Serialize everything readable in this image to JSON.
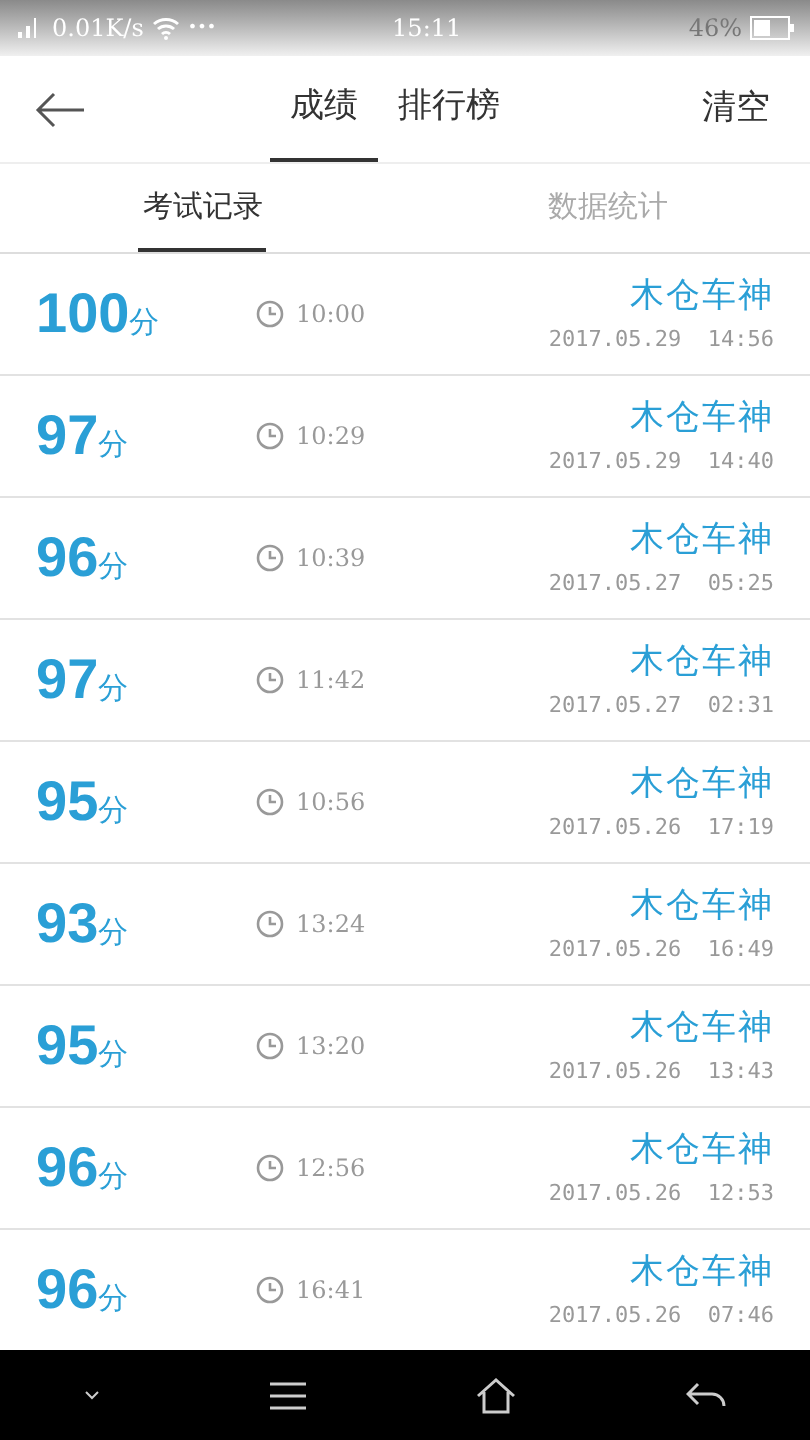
{
  "status_bar": {
    "speed": "0.01K/s",
    "dots": "•••",
    "time": "15:11",
    "battery": "46%"
  },
  "header": {
    "tabs": [
      {
        "label": "成绩",
        "selected": true
      },
      {
        "label": "排行榜",
        "selected": false
      }
    ],
    "action": "清空"
  },
  "sub_tabs": [
    {
      "label": "考试记录",
      "selected": true
    },
    {
      "label": "数据统计",
      "selected": false
    }
  ],
  "records": [
    {
      "score": "100",
      "unit": "分",
      "duration": "10:00",
      "name": "木仓车神",
      "date": "2017.05.29  14:56"
    },
    {
      "score": "97",
      "unit": "分",
      "duration": "10:29",
      "name": "木仓车神",
      "date": "2017.05.29  14:40"
    },
    {
      "score": "96",
      "unit": "分",
      "duration": "10:39",
      "name": "木仓车神",
      "date": "2017.05.27  05:25"
    },
    {
      "score": "97",
      "unit": "分",
      "duration": "11:42",
      "name": "木仓车神",
      "date": "2017.05.27  02:31"
    },
    {
      "score": "95",
      "unit": "分",
      "duration": "10:56",
      "name": "木仓车神",
      "date": "2017.05.26  17:19"
    },
    {
      "score": "93",
      "unit": "分",
      "duration": "13:24",
      "name": "木仓车神",
      "date": "2017.05.26  16:49"
    },
    {
      "score": "95",
      "unit": "分",
      "duration": "13:20",
      "name": "木仓车神",
      "date": "2017.05.26  13:43"
    },
    {
      "score": "96",
      "unit": "分",
      "duration": "12:56",
      "name": "木仓车神",
      "date": "2017.05.26  12:53"
    },
    {
      "score": "96",
      "unit": "分",
      "duration": "16:41",
      "name": "木仓车神",
      "date": "2017.05.26  07:46"
    }
  ]
}
